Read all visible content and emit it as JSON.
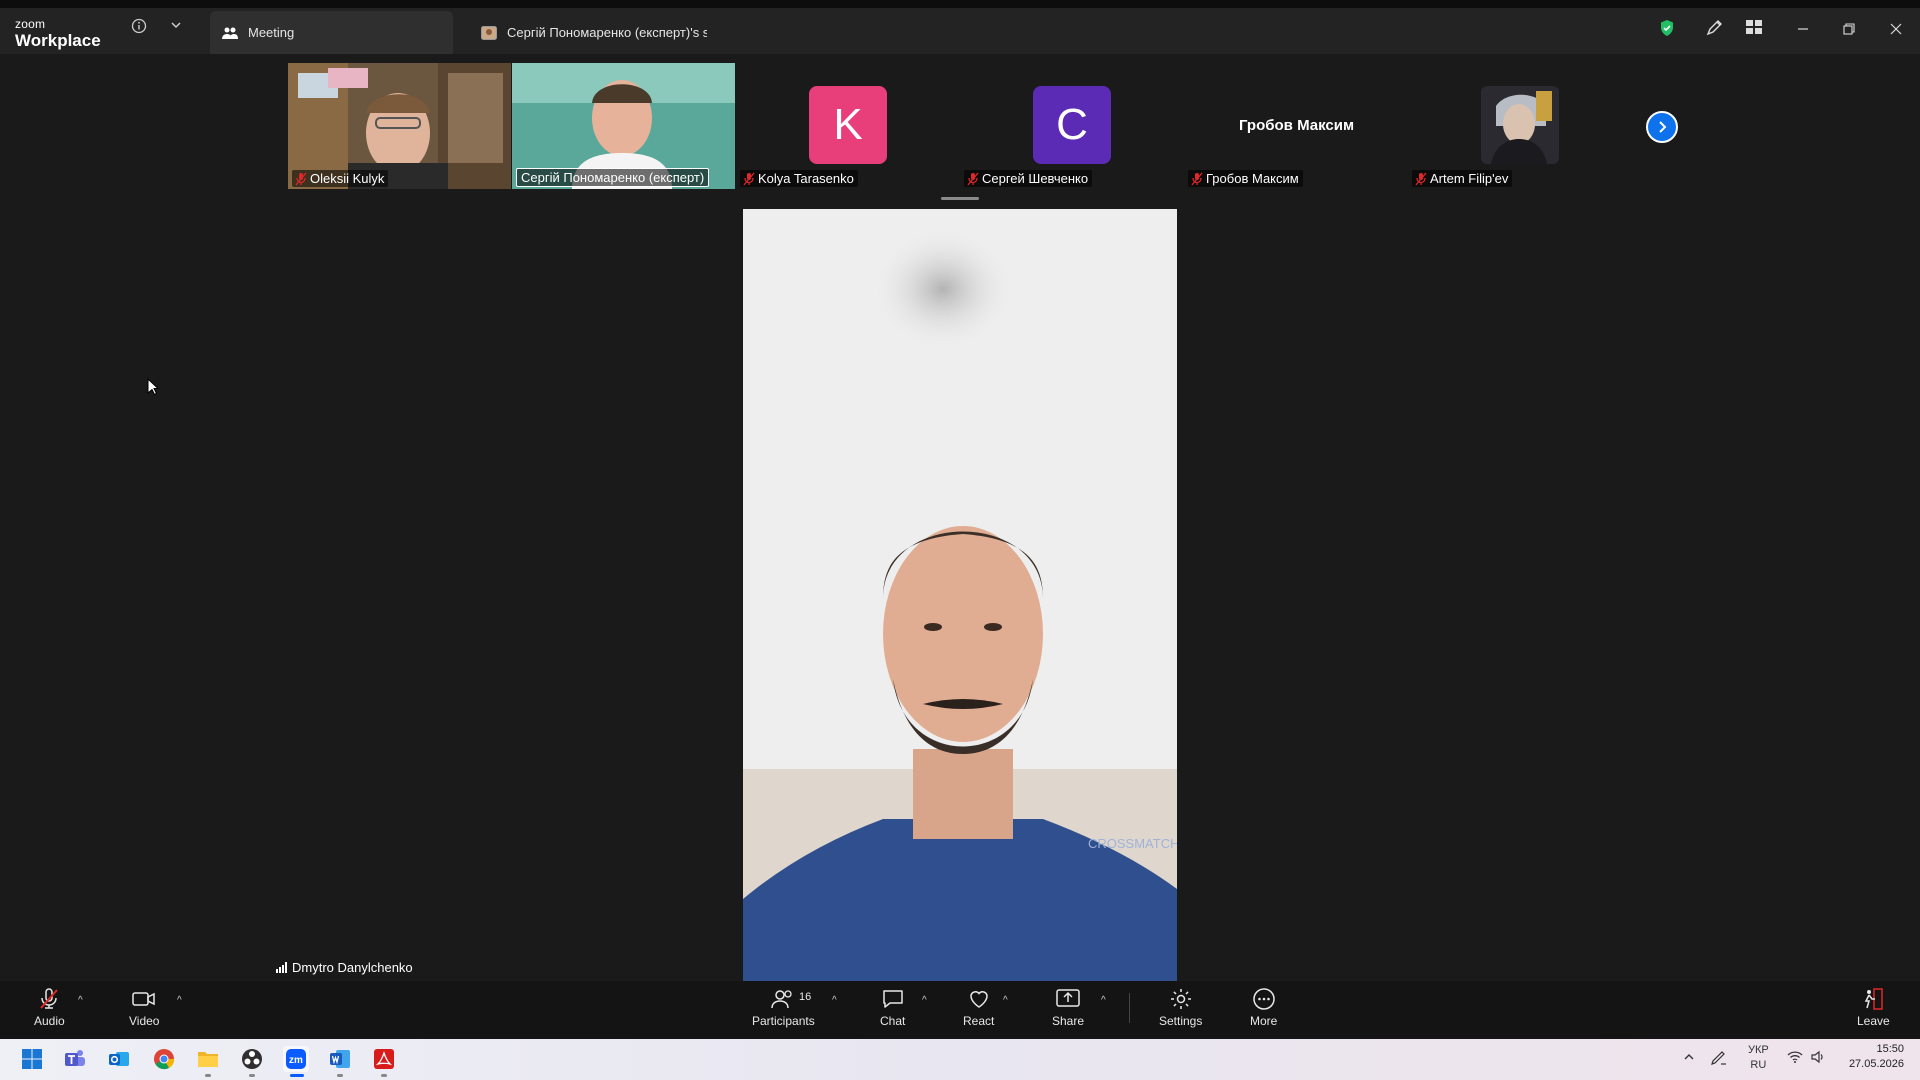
{
  "app": {
    "logo_small": "zoom",
    "logo_big": "Workplace"
  },
  "tabs": [
    {
      "label": "Meeting"
    },
    {
      "label": "Сергій Пономаренко (експерт)'s scre"
    }
  ],
  "participants_strip": [
    {
      "name": "Oleksii Kulyk",
      "type": "video"
    },
    {
      "name": "Сергій Пономаренко (експерт)",
      "type": "video"
    },
    {
      "name": "Kolya Tarasenko",
      "type": "avatar",
      "initial": "K",
      "color": "#e83e7a"
    },
    {
      "name": "Сергей Шевченко",
      "type": "avatar",
      "initial": "C",
      "color": "#5b2bb5"
    },
    {
      "name": "Гробов Максим",
      "type": "name",
      "display_name": "Гробов Максим"
    },
    {
      "name": "Artem Filip'ev",
      "type": "image"
    }
  ],
  "main_speaker": {
    "name": "Dmytro Danylchenko",
    "shirt_text": "CROSSMATCH"
  },
  "toolbar": {
    "audio": "Audio",
    "video": "Video",
    "participants": "Participants",
    "participants_count": "16",
    "chat": "Chat",
    "react": "React",
    "share": "Share",
    "settings": "Settings",
    "more": "More",
    "leave": "Leave"
  },
  "taskbar": {
    "lang_top": "УКР",
    "lang_bottom": "RU",
    "time": "15:50",
    "date": "27.05.2026"
  },
  "colors": {
    "accent_blue": "#0e72ed",
    "mute_red": "#e02828",
    "shield_green": "#21c065"
  }
}
